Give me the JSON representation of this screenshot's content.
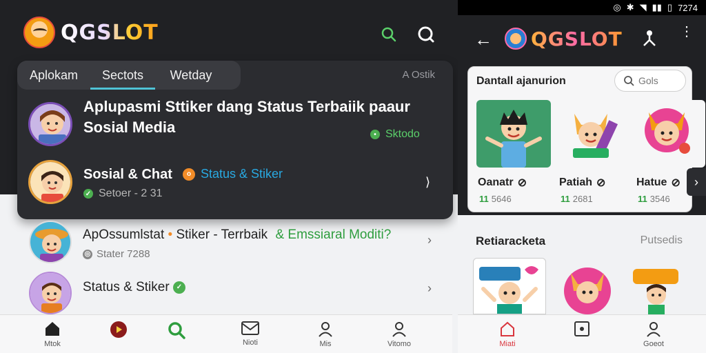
{
  "left": {
    "brand": "QGSLOT",
    "tabs": [
      "Aplokam",
      "Sectots",
      "Wetday"
    ],
    "tab_extra": "A Ostik",
    "featured": {
      "title": "Aplupasmi Sttiker dang Status Terbaiik paaur Sosial Media",
      "badge": "Sktodo"
    },
    "chat_row": {
      "title": "Sosial & Chat",
      "tag": "Status & Stiker",
      "sub": "Setoer - 2 31"
    },
    "list": [
      {
        "title_a": "ApOssumlstat",
        "title_b": "Stiker - Terrbaik",
        "title_c": "& Emssiaral Moditi?",
        "sub": "Stater  7288"
      },
      {
        "title_a": "Status & Stiker",
        "title_b": "",
        "title_c": "",
        "sub": ""
      }
    ],
    "bottom_nav": [
      "Mtok",
      "",
      "",
      "Nioti",
      "Mis",
      "Vitomo"
    ]
  },
  "right": {
    "status_time": "7274",
    "brand": "QGSLOT",
    "card_title": "Dantall ajanurion",
    "search_placeholder": "Gols",
    "stickers": [
      {
        "name": "Oanatr",
        "count": "5646"
      },
      {
        "name": "Patiah",
        "count": "2681"
      },
      {
        "name": "Hatue",
        "count": "3546"
      }
    ],
    "count_prefix": "11",
    "section_title": "Retiaracketa",
    "section_link": "Putsedis",
    "bottom_nav": [
      "Miati",
      "",
      "Goeot"
    ]
  },
  "colors": {
    "accent": "#4fc3d6",
    "green": "#2e9d3e",
    "orange": "#f28c28",
    "red": "#d9363e"
  }
}
